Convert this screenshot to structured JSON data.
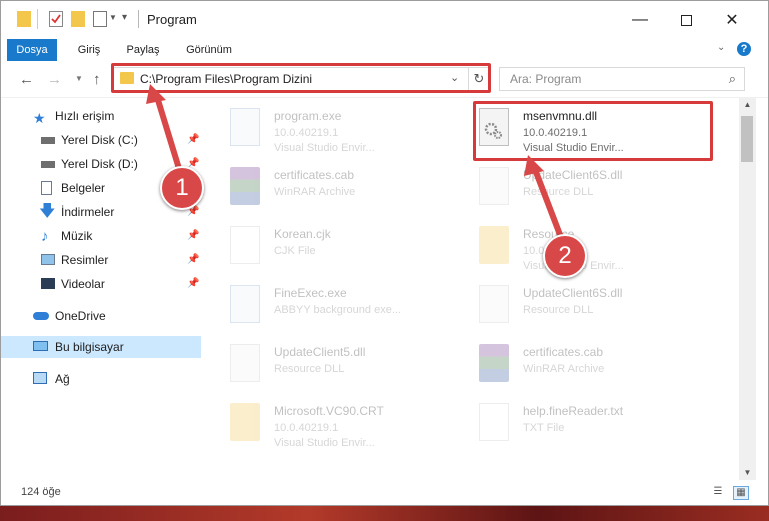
{
  "window": {
    "title": "Program"
  },
  "ribbon": {
    "tabs": [
      "Dosya",
      "Giriş",
      "Paylaş",
      "Görünüm"
    ]
  },
  "address": {
    "path": "C:\\Program Files\\Program Dizini"
  },
  "search": {
    "placeholder": "Ara: Program"
  },
  "sidebar": {
    "items": [
      {
        "label": "Hızlı erişim",
        "icon": "star-icon"
      },
      {
        "label": "Yerel Disk (C:)",
        "icon": "drive-icon"
      },
      {
        "label": "Yerel Disk (D:)",
        "icon": "drive-icon"
      },
      {
        "label": "Belgeler",
        "icon": "documents-icon"
      },
      {
        "label": "İndirmeler",
        "icon": "download-arrow-icon"
      },
      {
        "label": "Müzik",
        "icon": "music-note-icon"
      },
      {
        "label": "Resimler",
        "icon": "pictures-icon"
      },
      {
        "label": "Videolar",
        "icon": "film-icon"
      },
      {
        "label": "OneDrive",
        "icon": "cloud-icon"
      },
      {
        "label": "Bu bilgisayar",
        "icon": "computer-icon"
      },
      {
        "label": "Ağ",
        "icon": "network-icon"
      }
    ]
  },
  "files": [
    {
      "name": "program.exe",
      "line2": "10.0.40219.1",
      "line3": "Visual Studio Envir...",
      "icon": "installer-icon"
    },
    {
      "name": "msenvmnu.dll",
      "line2": "10.0.40219.1",
      "line3": "Visual Studio Envir...",
      "icon": "gear-document-icon"
    },
    {
      "name": "certificates.cab",
      "line2": "WinRAR Archive",
      "line3": "",
      "icon": "winrar-icon"
    },
    {
      "name": "UpdateClient6S.dll",
      "line2": "Resource DLL",
      "line3": "",
      "icon": "gear-document-icon"
    },
    {
      "name": "Korean.cjk",
      "line2": "CJK File",
      "line3": "",
      "icon": "blank-document-icon"
    },
    {
      "name": "Resource",
      "line2": "10.0.40219.1",
      "line3": "Visual Studio Envir...",
      "icon": "folder-doc-icon"
    },
    {
      "name": "FineExec.exe",
      "line2": "ABBYY background exe...",
      "line3": "",
      "icon": "app-window-icon"
    },
    {
      "name": "UpdateClient6S.dll",
      "line2": "Resource DLL",
      "line3": "",
      "icon": "gear-document-icon"
    },
    {
      "name": "UpdateClient5.dll",
      "line2": "Resource DLL",
      "line3": "",
      "icon": "gear-document-icon"
    },
    {
      "name": "certificates.cab",
      "line2": "WinRAR Archive",
      "line3": "",
      "icon": "winrar-icon"
    },
    {
      "name": "Microsoft.VC90.CRT",
      "line2": "10.0.40219.1",
      "line3": "Visual Studio Envir...",
      "icon": "folder-doc-icon"
    },
    {
      "name": "help.fineReader.txt",
      "line2": "TXT File",
      "line3": "",
      "icon": "blank-document-icon"
    }
  ],
  "status": {
    "item_count": "124 öğe"
  },
  "annotations": {
    "step1": "1",
    "step2": "2"
  },
  "colors": {
    "accent": "#1979ca",
    "highlight_box": "#d73a3a",
    "badge": "#d84848",
    "selection": "#cce8ff"
  }
}
